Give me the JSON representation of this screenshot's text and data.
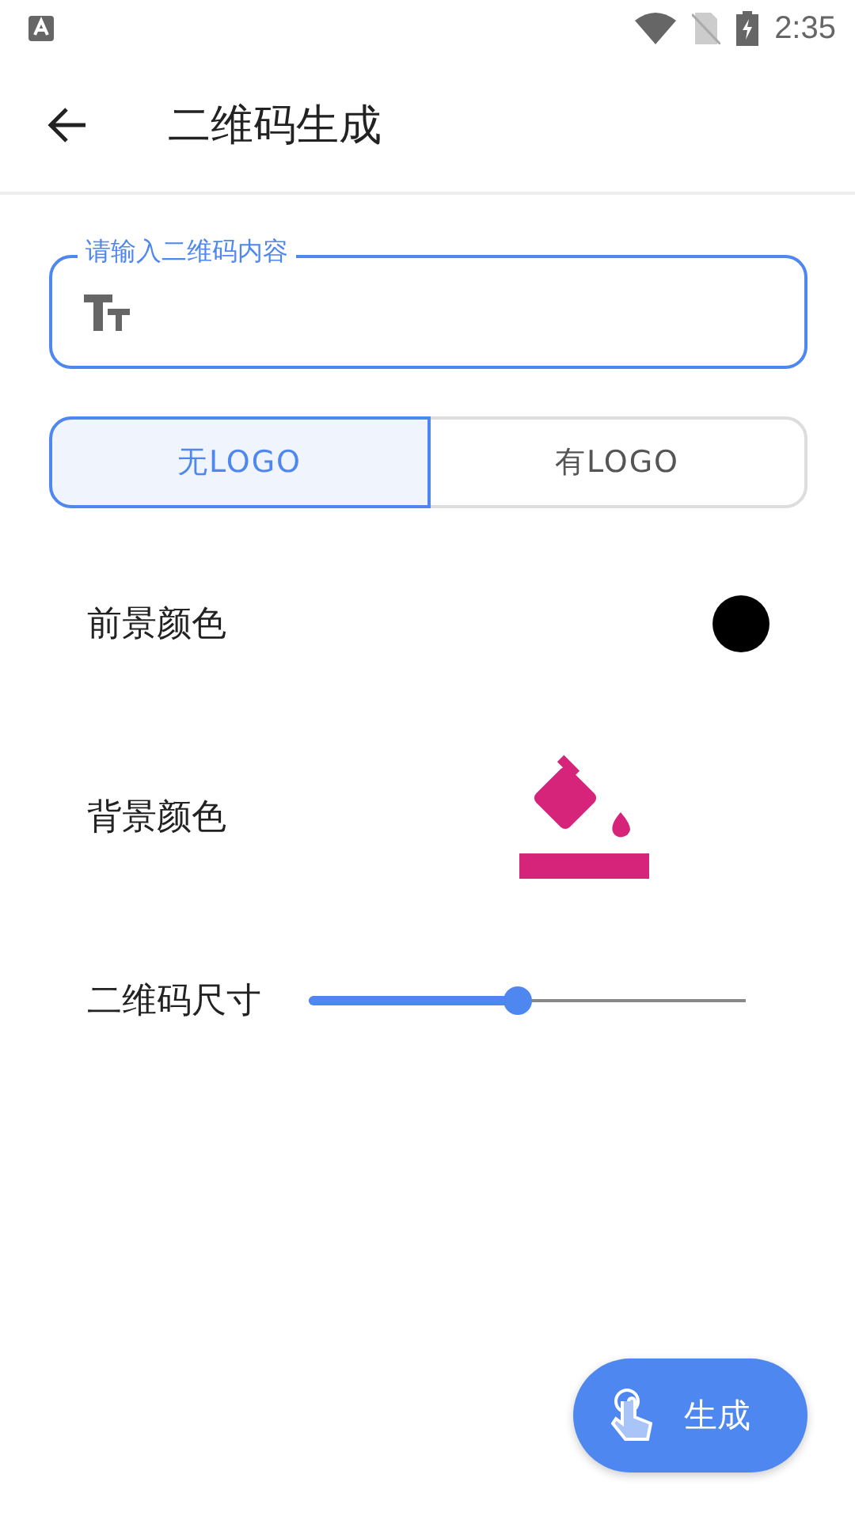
{
  "status_bar": {
    "time": "2:35"
  },
  "app_bar": {
    "title": "二维码生成"
  },
  "content_field": {
    "label": "请输入二维码内容"
  },
  "logo_options": [
    {
      "label": "无LOGO",
      "selected": true
    },
    {
      "label": "有LOGO",
      "selected": false
    }
  ],
  "foreground_color": {
    "label": "前景颜色",
    "color": "#000000"
  },
  "background_color": {
    "label": "背景颜色",
    "color": "#d6247a"
  },
  "size": {
    "label": "二维码尺寸",
    "level": 0.48
  },
  "generate_button": {
    "label": "生成"
  }
}
